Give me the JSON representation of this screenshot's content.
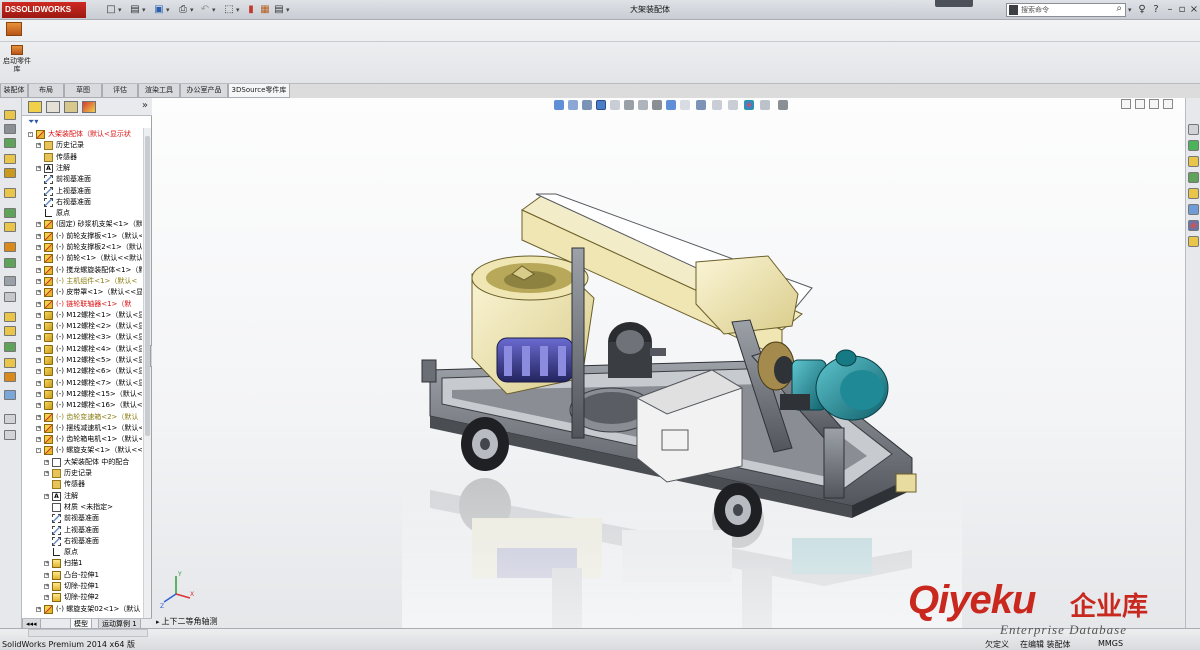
{
  "app": {
    "brand": "SOLIDWORKS",
    "brand_mark": "DS",
    "doc_title": "大架装配体"
  },
  "search": {
    "placeholder": "搜索命令"
  },
  "command_manager": {
    "launch_label": "启动零件库"
  },
  "tabs": [
    "装配体",
    "布局",
    "草图",
    "评估",
    "渲染工具",
    "办公室产品",
    "3DSource零件库"
  ],
  "active_tab": 6,
  "feature_tree": {
    "rows": [
      {
        "indent": 0,
        "icon": "asm",
        "exp": "-",
        "style": "red",
        "text": "大架装配体（默认<显示状"
      },
      {
        "indent": 1,
        "icon": "folder",
        "exp": "+",
        "style": "",
        "text": "历史记录"
      },
      {
        "indent": 1,
        "icon": "folder",
        "exp": "",
        "style": "",
        "text": "传感器"
      },
      {
        "indent": 1,
        "icon": "note",
        "exp": "+",
        "style": "",
        "text": "注解"
      },
      {
        "indent": 1,
        "icon": "plane",
        "exp": "",
        "style": "",
        "text": "前视基准面"
      },
      {
        "indent": 1,
        "icon": "plane",
        "exp": "",
        "style": "",
        "text": "上视基准面"
      },
      {
        "indent": 1,
        "icon": "plane",
        "exp": "",
        "style": "",
        "text": "右视基准面"
      },
      {
        "indent": 1,
        "icon": "origin",
        "exp": "",
        "style": "",
        "text": "原点"
      },
      {
        "indent": 1,
        "icon": "asm",
        "exp": "+",
        "style": "",
        "text": "(固定) 砂浆机支架<1>（默"
      },
      {
        "indent": 1,
        "icon": "asm",
        "exp": "+",
        "style": "",
        "text": "(-) 前轮支撑板<1>（默认<"
      },
      {
        "indent": 1,
        "icon": "asm",
        "exp": "+",
        "style": "",
        "text": "(-) 前轮支撑板2<1>（默认"
      },
      {
        "indent": 1,
        "icon": "asm",
        "exp": "+",
        "style": "",
        "text": "(-) 前轮<1>（默认<<默认"
      },
      {
        "indent": 1,
        "icon": "asm",
        "exp": "+",
        "style": "",
        "text": "(-) 搅龙螺旋装配体<1>（默"
      },
      {
        "indent": 1,
        "icon": "asm",
        "exp": "+",
        "style": "olive",
        "text": "(-) 主机组件<1>（默认<"
      },
      {
        "indent": 1,
        "icon": "asm",
        "exp": "+",
        "style": "",
        "text": "(-) 皮带罩<1>（默认<<显"
      },
      {
        "indent": 1,
        "icon": "asm",
        "exp": "+",
        "style": "red",
        "text": "(-) 链轮联轴器<1>（默"
      },
      {
        "indent": 1,
        "icon": "part",
        "exp": "+",
        "style": "",
        "text": "(-) M12螺栓<1>（默认<显"
      },
      {
        "indent": 1,
        "icon": "part",
        "exp": "+",
        "style": "",
        "text": "(-) M12螺栓<2>（默认<显"
      },
      {
        "indent": 1,
        "icon": "part",
        "exp": "+",
        "style": "",
        "text": "(-) M12螺栓<3>（默认<显"
      },
      {
        "indent": 1,
        "icon": "part",
        "exp": "+",
        "style": "",
        "text": "(-) M12螺栓<4>（默认<显"
      },
      {
        "indent": 1,
        "icon": "part",
        "exp": "+",
        "style": "",
        "text": "(-) M12螺栓<5>（默认<显"
      },
      {
        "indent": 1,
        "icon": "part",
        "exp": "+",
        "style": "",
        "text": "(-) M12螺栓<6>（默认<显"
      },
      {
        "indent": 1,
        "icon": "part",
        "exp": "+",
        "style": "",
        "text": "(-) M12螺栓<7>（默认<显"
      },
      {
        "indent": 1,
        "icon": "part",
        "exp": "+",
        "style": "",
        "text": "(-) M12螺栓<15>（默认<"
      },
      {
        "indent": 1,
        "icon": "part",
        "exp": "+",
        "style": "",
        "text": "(-) M12螺栓<16>（默认<"
      },
      {
        "indent": 1,
        "icon": "asm",
        "exp": "+",
        "style": "olive",
        "text": "(-) 齿轮变速箱<2>（默认"
      },
      {
        "indent": 1,
        "icon": "asm",
        "exp": "+",
        "style": "",
        "text": "(-) 摆线减速机<1>（默认<"
      },
      {
        "indent": 1,
        "icon": "asm",
        "exp": "+",
        "style": "",
        "text": "(-) 齿轮箱电机<1>（默认<"
      },
      {
        "indent": 1,
        "icon": "asm",
        "exp": "-",
        "style": "",
        "text": "(-) 螺旋支架<1>（默认<<"
      },
      {
        "indent": 2,
        "icon": "mate",
        "exp": "+",
        "style": "",
        "text": "大架装配体 中的配合"
      },
      {
        "indent": 2,
        "icon": "folder",
        "exp": "+",
        "style": "",
        "text": "历史记录"
      },
      {
        "indent": 2,
        "icon": "folder",
        "exp": "",
        "style": "",
        "text": "传感器"
      },
      {
        "indent": 2,
        "icon": "note",
        "exp": "+",
        "style": "",
        "text": "注解"
      },
      {
        "indent": 2,
        "icon": "mate",
        "exp": "",
        "style": "",
        "text": "材质 <未指定>"
      },
      {
        "indent": 2,
        "icon": "plane",
        "exp": "",
        "style": "",
        "text": "前视基准面"
      },
      {
        "indent": 2,
        "icon": "plane",
        "exp": "",
        "style": "",
        "text": "上视基准面"
      },
      {
        "indent": 2,
        "icon": "plane",
        "exp": "",
        "style": "",
        "text": "右视基准面"
      },
      {
        "indent": 2,
        "icon": "origin",
        "exp": "",
        "style": "",
        "text": "原点"
      },
      {
        "indent": 2,
        "icon": "feat",
        "exp": "+",
        "style": "",
        "text": "扫描1"
      },
      {
        "indent": 2,
        "icon": "feat",
        "exp": "+",
        "style": "",
        "text": "凸台-拉伸1"
      },
      {
        "indent": 2,
        "icon": "feat",
        "exp": "+",
        "style": "",
        "text": "切除-拉伸1"
      },
      {
        "indent": 2,
        "icon": "feat",
        "exp": "+",
        "style": "",
        "text": "切除-拉伸2"
      },
      {
        "indent": 1,
        "icon": "asm",
        "exp": "+",
        "style": "",
        "text": "(-) 螺旋支架02<1>（默认"
      }
    ]
  },
  "bottom_tabs": [
    "模型",
    "运动算例 1"
  ],
  "viewport": {
    "view_name": "上下二等角轴测"
  },
  "status": {
    "product": "SolidWorks Premium 2014 x64 版",
    "state": "欠定义",
    "mode": "在编辑 装配体",
    "units": "MMGS"
  },
  "watermark": {
    "brand": "Qiyeku",
    "brand_cn": "企业库",
    "tagline": "Enterprise Database"
  },
  "colors": {
    "frame_tan": "#efe6b3",
    "frame_gray": "#7b7f86",
    "motor_teal": "#1f8a96",
    "crusher_blue": "#3a3b8c",
    "brand_red": "#c8281e"
  }
}
